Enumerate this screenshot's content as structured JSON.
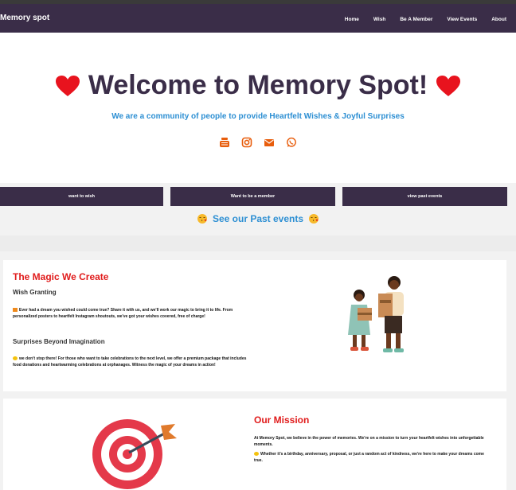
{
  "brand": "Memory spot",
  "nav": [
    "Home",
    "Wish",
    "Be A Member",
    "View Events",
    "About"
  ],
  "hero": {
    "title": "Welcome to Memory Spot!",
    "subtitle": "We are a community of people to provide Heartfelt Wishes & Joyful Surprises"
  },
  "social_icons": [
    "youtube-icon",
    "instagram-icon",
    "email-icon",
    "whatsapp-icon"
  ],
  "buttons": [
    "want to wish",
    "Want to be a member",
    "view past events"
  ],
  "past_events_label": "See our Past events",
  "magic": {
    "title": "The Magic We Create",
    "wish_heading": "Wish Granting",
    "wish_text": "Ever had a dream you wished could come true? Share it with us, and we'll work our magic to bring it to life. From personalized posters to heartfelt Instagram shoutouts, we've got your wishes covered, free of charge!",
    "surprise_heading": "Surprises Beyond Imagination",
    "surprise_text": "we don't stop there! For those who want to take celebrations to the next level, we offer a premium package that includes food donations and heartwarming celebrations at orphanages. Witness the magic of your dreams in action!"
  },
  "mission": {
    "title": "Our Mission",
    "text1": "At Memory Spot, we believe in the power of memories. We're on a mission to turn your heartfelt wishes into unforgettable moments.",
    "text2": "Whether it's a birthday, anniversary, proposal, or just a random act of kindness, we're here to make your dreams come true."
  },
  "colors": {
    "nav_bg": "#3a2d48",
    "accent_blue": "#2d8fd3",
    "heading_red": "#e01b1b",
    "social_orange": "#e85d0c"
  }
}
